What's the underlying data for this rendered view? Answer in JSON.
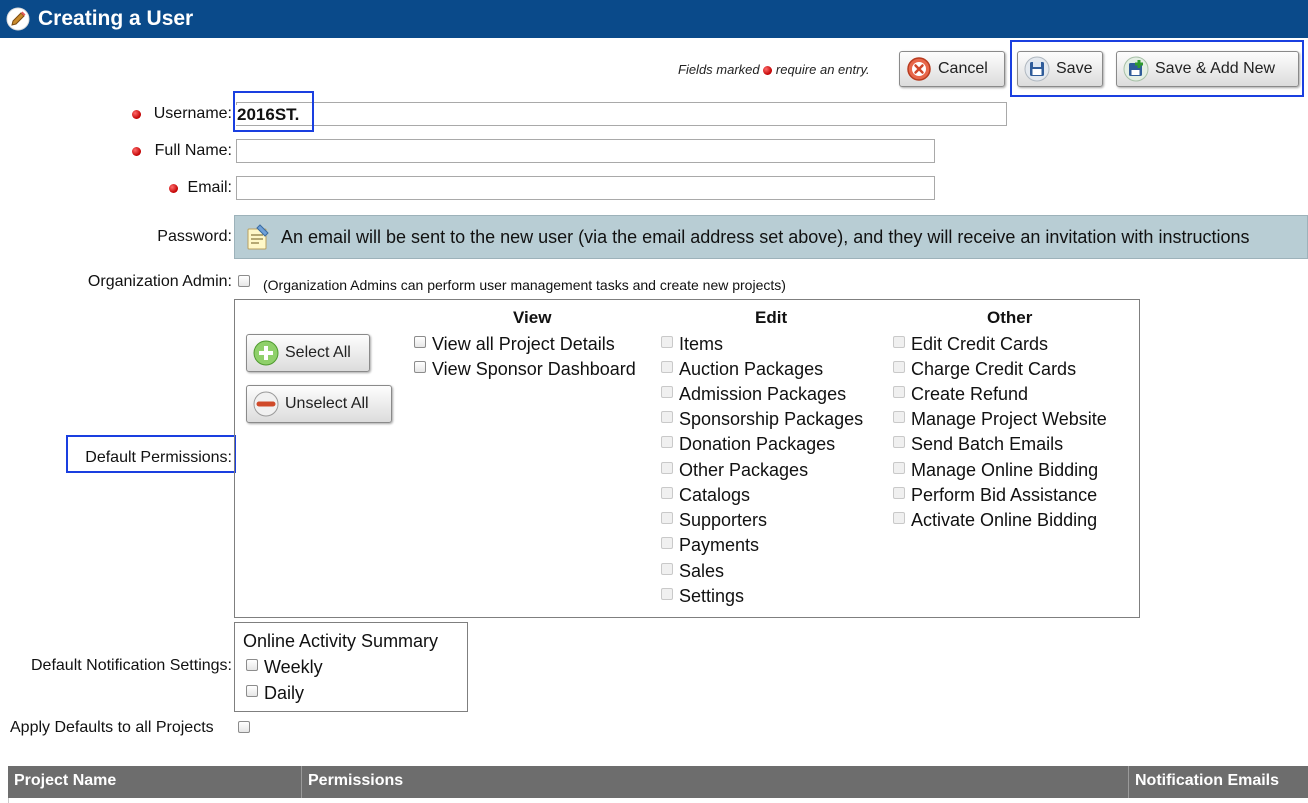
{
  "header": {
    "title": "Creating a User",
    "icon": "pencil-icon",
    "color": "#0a4a8a"
  },
  "toolbar": {
    "required_note_prefix": "Fields marked",
    "required_note_suffix": "require an entry.",
    "cancel_label": "Cancel",
    "save_label": "Save",
    "save_add_label": "Save & Add New"
  },
  "form": {
    "username_label": "Username:",
    "username_value": "2016ST.",
    "fullname_label": "Full Name:",
    "fullname_value": "",
    "email_label": "Email:",
    "email_value": "",
    "password_label": "Password:",
    "password_note": "An email will be sent to the new user (via the email address set above), and they will receive an invitation with instructions",
    "org_admin_label": "Organization Admin:",
    "org_admin_note": "(Organization Admins can perform user management tasks and create new projects)",
    "default_permissions_label": "Default Permissions:",
    "default_notification_label": "Default Notification Settings:",
    "apply_defaults_label": "Apply Defaults to all Projects"
  },
  "permissions": {
    "select_all_label": "Select All",
    "unselect_all_label": "Unselect All",
    "view_header": "View",
    "edit_header": "Edit",
    "other_header": "Other",
    "view": [
      "View all Project Details",
      "View Sponsor Dashboard"
    ],
    "edit": [
      "Items",
      "Auction Packages",
      "Admission Packages",
      "Sponsorship Packages",
      "Donation Packages",
      "Other Packages",
      "Catalogs",
      "Supporters",
      "Payments",
      "Sales",
      "Settings"
    ],
    "other": [
      "Edit Credit Cards",
      "Charge Credit Cards",
      "Create Refund",
      "Manage Project Website",
      "Send Batch Emails",
      "Manage Online Bidding",
      "Perform Bid Assistance",
      "Activate Online Bidding"
    ]
  },
  "notifications": {
    "title": "Online Activity Summary",
    "options": [
      "Weekly",
      "Daily"
    ]
  },
  "table": {
    "headers": [
      "Project Name",
      "Permissions",
      "Notification Emails"
    ]
  },
  "colors": {
    "header_bg": "#0a4a8a",
    "note_bg": "#b8cdd4",
    "table_head": "#6d6d6d",
    "highlight": "#1a3fe0"
  }
}
